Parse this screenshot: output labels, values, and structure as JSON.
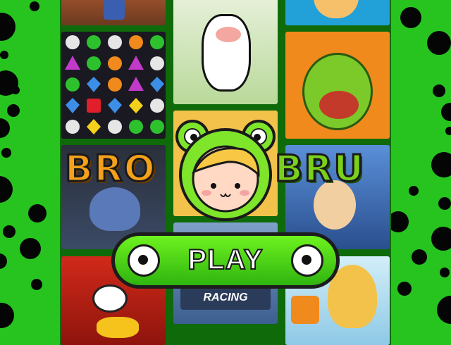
{
  "logo": {
    "word_left": "BRO",
    "word_right": "BRU"
  },
  "play_button": {
    "label": "PLAY"
  },
  "thumbnails": {
    "racing_title": "RACING"
  },
  "colors": {
    "background": "#27c41f",
    "grid_border": "#0f6a0a",
    "play_fill": "#4fd81a",
    "dots": "#050505"
  }
}
